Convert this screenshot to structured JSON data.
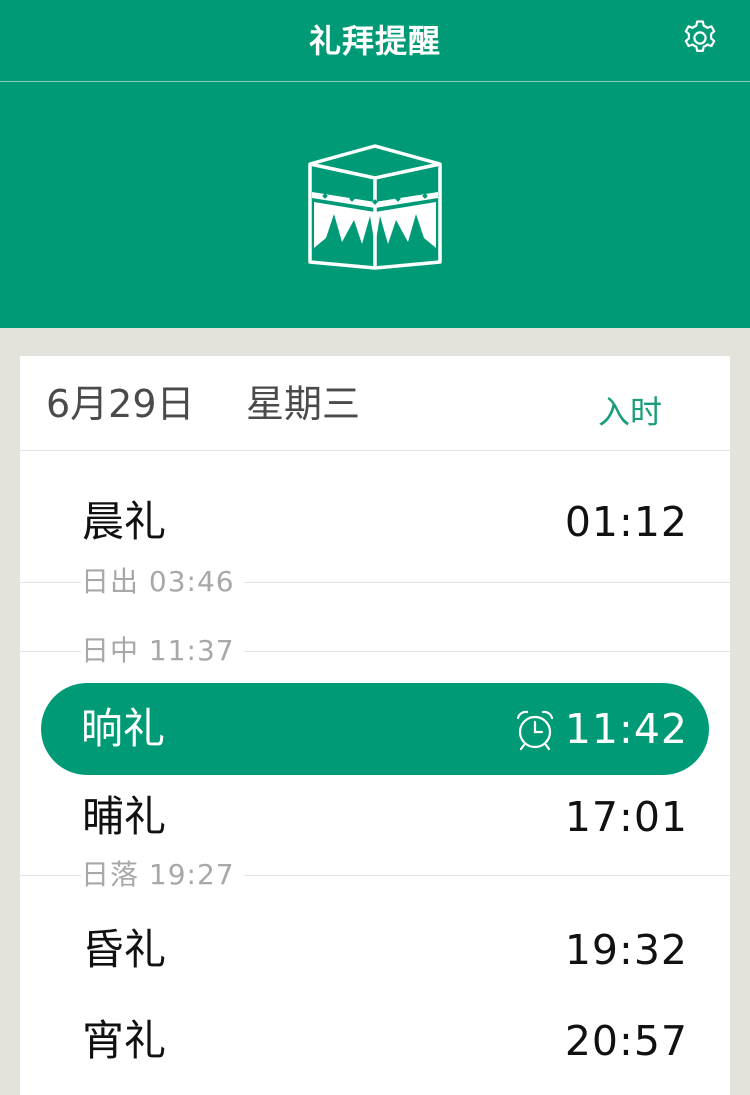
{
  "header": {
    "title": "礼拜提醒",
    "settings_icon": "gear-icon"
  },
  "hero": {
    "icon": "kaaba-icon"
  },
  "date_bar": {
    "date": "6月29日",
    "weekday": "星期三",
    "mode": "入时"
  },
  "prayers": [
    {
      "name": "晨礼",
      "time": "01:12"
    },
    {
      "name": "晌礼",
      "time": "11:42",
      "active": true,
      "alarm_icon": "alarm-clock-icon"
    },
    {
      "name": "晡礼",
      "time": "17:01"
    },
    {
      "name": "昏礼",
      "time": "19:32"
    },
    {
      "name": "宵礼",
      "time": "20:57"
    }
  ],
  "events": [
    {
      "label": "日出 03:46"
    },
    {
      "label": "日中 11:37"
    },
    {
      "label": "日落 19:27"
    }
  ],
  "colors": {
    "primary": "#009b76",
    "accent_text": "#1a9d7b",
    "background": "#e3e3dc",
    "muted_text": "#a8a8a8"
  }
}
